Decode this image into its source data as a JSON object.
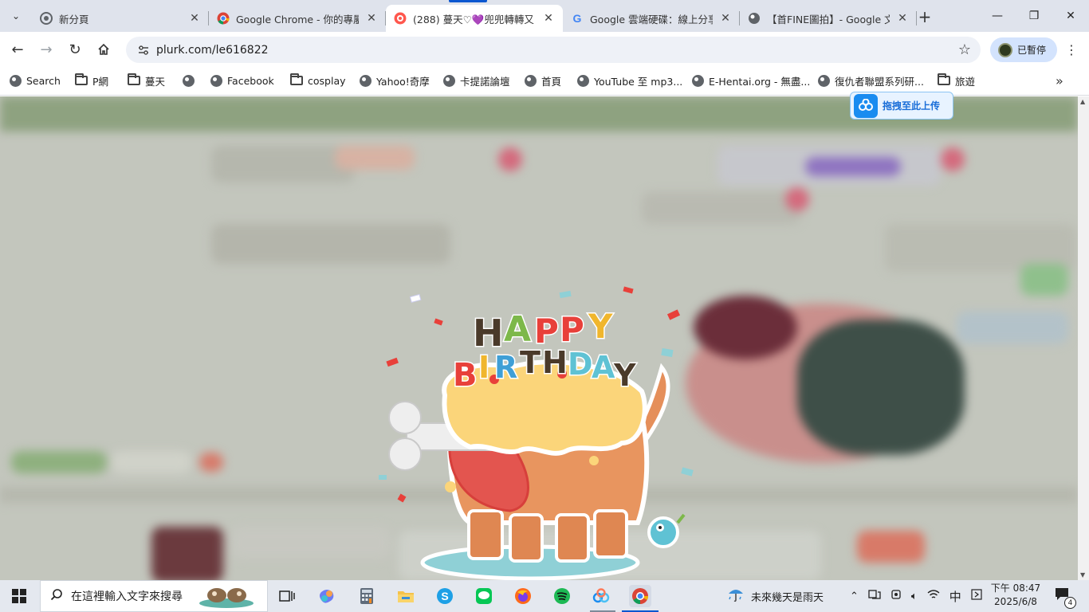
{
  "browser": {
    "tabs": [
      {
        "title": "新分頁",
        "favicon": "chrome-icon",
        "active": false
      },
      {
        "title": "Google Chrome - 你的專屬瀏覽器",
        "favicon": "google-chrome-icon",
        "active": false
      },
      {
        "title": "(288) 蔓天♡💜兜兜轉轉又",
        "favicon": "plurk-icon",
        "active": true
      },
      {
        "title": "Google 雲端硬碟：線上分享",
        "favicon": "google-g-icon",
        "active": false
      },
      {
        "title": "【首FINE圖拍】- Google 文",
        "favicon": "globe-icon",
        "active": false
      }
    ],
    "url": "plurk.com/le616822",
    "profile_label": "已暫停"
  },
  "bookmarks": [
    {
      "label": "Search",
      "icon": "globe-icon"
    },
    {
      "label": "P網",
      "icon": "folder-icon"
    },
    {
      "label": "蔓天",
      "icon": "folder-icon"
    },
    {
      "label": "",
      "icon": "globe-icon"
    },
    {
      "label": "Facebook",
      "icon": "globe-icon"
    },
    {
      "label": "cosplay",
      "icon": "folder-icon"
    },
    {
      "label": "Yahoo!奇摩",
      "icon": "globe-icon"
    },
    {
      "label": "卡提諾論壇",
      "icon": "globe-icon"
    },
    {
      "label": "首頁",
      "icon": "globe-icon"
    },
    {
      "label": "YouTube 至 mp3...",
      "icon": "globe-icon"
    },
    {
      "label": "E-Hentai.org - 無盡...",
      "icon": "globe-icon"
    },
    {
      "label": "復仇者聯盟系列研...",
      "icon": "globe-icon"
    },
    {
      "label": "旅遊",
      "icon": "folder-icon"
    }
  ],
  "page": {
    "upload_chip_label": "拖拽至此上传",
    "sticker_text": {
      "line1": "HAPPY",
      "line2": "BIRTHDAY"
    }
  },
  "taskbar": {
    "search_placeholder": "在這裡輸入文字來搜尋",
    "weather_text": "未來幾天是雨天",
    "ime": "中",
    "time": "下午 08:47",
    "date": "2025/6/8",
    "notification_count": "4"
  },
  "colors": {
    "accent": "#0b57d0",
    "tabstrip": "#dfe3ec",
    "overlay": "#c3c6bd",
    "plurk_green": "#8ea280"
  }
}
